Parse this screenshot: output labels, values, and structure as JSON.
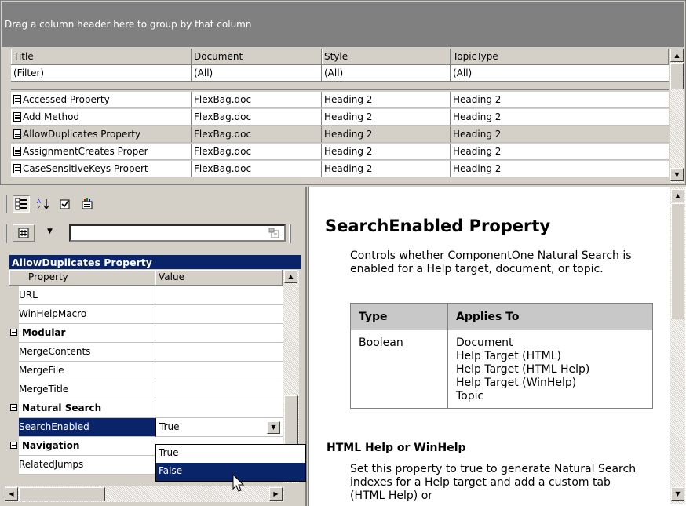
{
  "grid": {
    "group_hint": "Drag a column header here to group by that column",
    "columns": [
      "Title",
      "Document",
      "Style",
      "TopicType"
    ],
    "filter": [
      "(Filter)",
      "(All)",
      "(All)",
      "(All)"
    ],
    "rows": [
      [
        "Accessed Property",
        "FlexBag.doc",
        "Heading 2",
        "Heading 2"
      ],
      [
        "Add Method",
        "FlexBag.doc",
        "Heading 2",
        "Heading 2"
      ],
      [
        "AllowDuplicates Property",
        "FlexBag.doc",
        "Heading 2",
        "Heading 2"
      ],
      [
        "AssignmentCreates Proper",
        "FlexBag.doc",
        "Heading 2",
        "Heading 2"
      ],
      [
        "CaseSensitiveKeys Propert",
        "FlexBag.doc",
        "Heading 2",
        "Heading 2"
      ]
    ],
    "selected_row": 2
  },
  "propgrid": {
    "object_title": "AllowDuplicates Property",
    "headers": {
      "property": "Property",
      "value": "Value"
    },
    "rows": [
      {
        "name": "URL",
        "value": ""
      },
      {
        "name": "WinHelpMacro",
        "value": ""
      },
      {
        "name": "Modular",
        "value": "",
        "category": true
      },
      {
        "name": "MergeContents",
        "value": ""
      },
      {
        "name": "MergeFile",
        "value": ""
      },
      {
        "name": "MergeTitle",
        "value": ""
      },
      {
        "name": "Natural Search",
        "value": "",
        "category": true
      },
      {
        "name": "SearchEnabled",
        "value": "True",
        "selected": true
      },
      {
        "name": "Navigation",
        "value": "",
        "category": true
      },
      {
        "name": "RelatedJumps",
        "value": ""
      }
    ],
    "dropdown_options": [
      "True",
      "False"
    ],
    "dropdown_highlight": "False"
  },
  "help": {
    "title": "SearchEnabled Property",
    "description": "Controls whether ComponentOne Natural Search is enabled for a Help target, document, or topic.",
    "table": {
      "col1": "Type",
      "col2": "Applies To",
      "type": "Boolean",
      "applies": [
        "Document",
        "Help Target (HTML)",
        "Help Target (HTML Help)",
        "Help Target (WinHelp)",
        "Topic"
      ]
    },
    "subheading": "HTML Help or WinHelp",
    "body": "Set this property to true to generate Natural Search indexes for a Help target and add a custom tab (HTML Help) or"
  },
  "icons": {
    "doc": "document-icon",
    "categorized": "categorized-icon",
    "alphabetical": "sort-az-icon",
    "property_pages": "property-pages-icon",
    "wizard": "wizard-icon"
  }
}
